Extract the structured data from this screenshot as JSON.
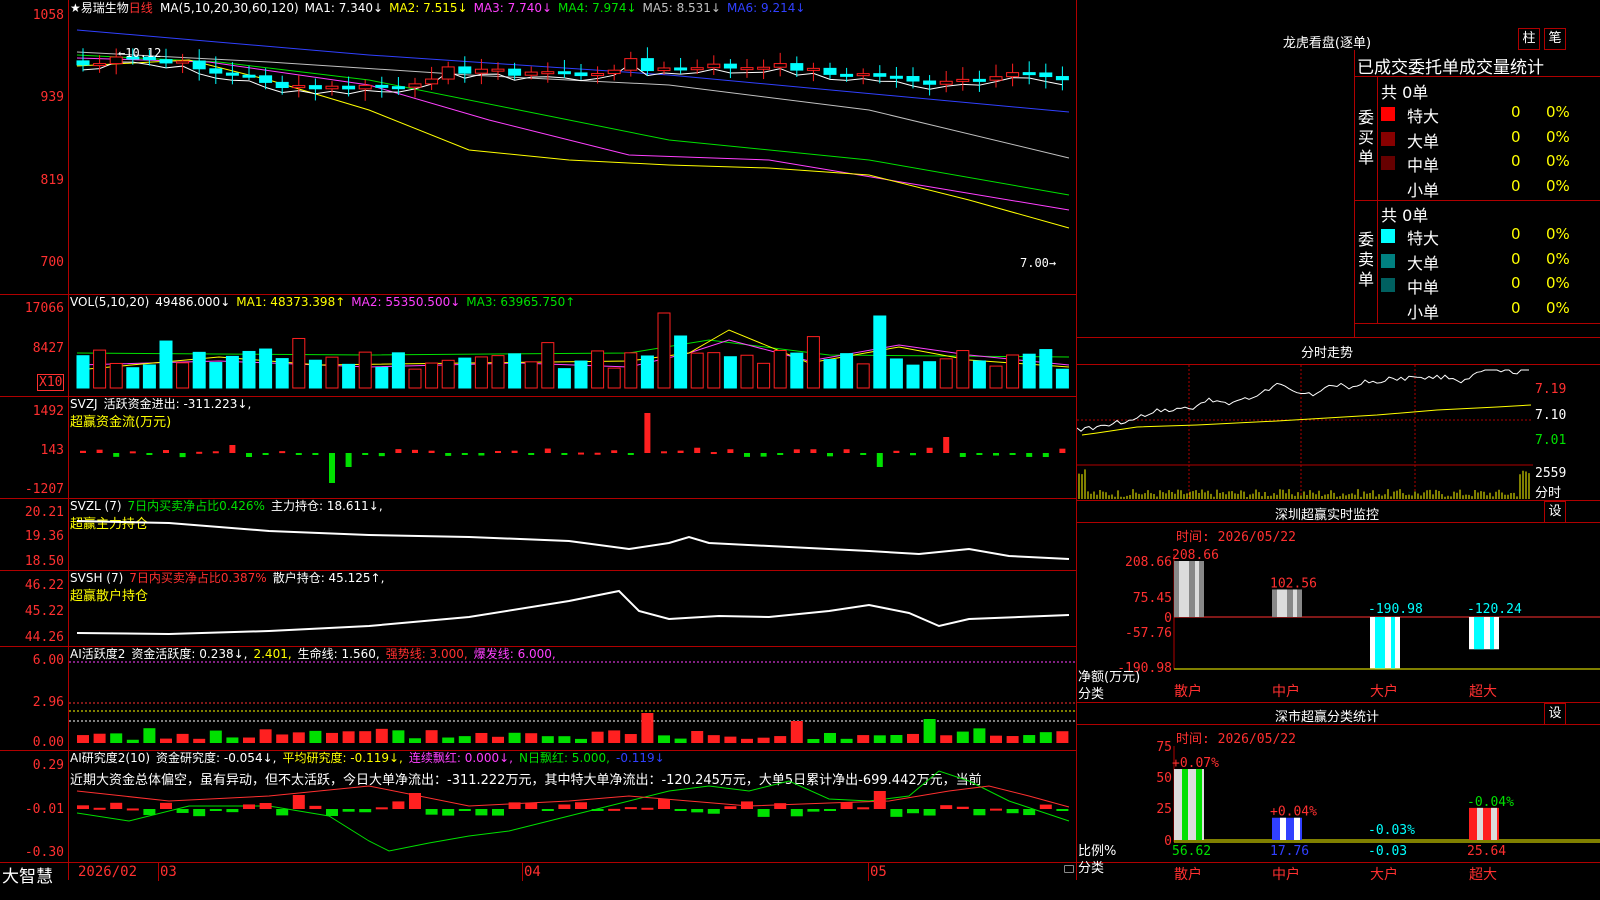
{
  "brand": "大智慧",
  "stock": {
    "name": "★易瑞生物",
    "period": "日线"
  },
  "price_pane": {
    "ma_header": [
      {
        "text": "MA(5,10,20,30,60,120)",
        "color": "#ffffff"
      },
      {
        "text": "MA1: 7.340↓",
        "color": "#ffffff"
      },
      {
        "text": "MA2: 7.515↓",
        "color": "#ffff00"
      },
      {
        "text": "MA3: 7.740↓",
        "color": "#ff40ff"
      },
      {
        "text": "MA4: 7.974↓",
        "color": "#00e000"
      },
      {
        "text": "MA5: 8.531↓",
        "color": "#c0c0c0"
      },
      {
        "text": "MA6: 9.214↓",
        "color": "#3040ff"
      }
    ],
    "axis": [
      "1058",
      "939",
      "819",
      "700"
    ],
    "high_label": "←10.12",
    "low_label": "7.00→"
  },
  "vol_pane": {
    "header": [
      {
        "text": "VOL(5,10,20)",
        "color": "#ffffff"
      },
      {
        "text": "49486.000↓",
        "color": "#ffffff"
      },
      {
        "text": "MA1: 48373.398↑",
        "color": "#ffff00"
      },
      {
        "text": "MA2: 55350.500↓",
        "color": "#ff40ff"
      },
      {
        "text": "MA3: 63965.750↑",
        "color": "#00e000"
      }
    ],
    "axis": [
      "17066",
      "8427"
    ],
    "unit": "X10"
  },
  "svzj_pane": {
    "header": [
      {
        "text": "SVZJ",
        "color": "#ffffff"
      },
      {
        "text": "活跃资金进出: -311.223↓,",
        "color": "#ffffff"
      }
    ],
    "subtitle": "超赢资金流(万元)",
    "axis": [
      "1492",
      "143",
      "-1207"
    ]
  },
  "svzl_pane": {
    "header": [
      {
        "text": "SVZL (7)",
        "color": "#ffffff"
      },
      {
        "text": "7日内买卖净占比0.426%",
        "color": "#00e000"
      },
      {
        "text": "主力持仓: 18.611↓,",
        "color": "#ffffff"
      }
    ],
    "subtitle": "超赢主力持仓",
    "axis": [
      "20.21",
      "19.36",
      "18.50"
    ]
  },
  "svsh_pane": {
    "header": [
      {
        "text": "SVSH (7)",
        "color": "#ffffff"
      },
      {
        "text": "7日内买卖净占比0.387%",
        "color": "#ff3030"
      },
      {
        "text": "散户持仓: 45.125↑,",
        "color": "#ffffff"
      }
    ],
    "subtitle": "超赢散户持仓",
    "axis": [
      "46.22",
      "45.22",
      "44.26"
    ]
  },
  "ai_pane": {
    "header": [
      {
        "text": "AI活跃度2",
        "color": "#ffffff"
      },
      {
        "text": "资金活跃度: 0.238↓,",
        "color": "#ffffff"
      },
      {
        "text": "2.401,",
        "color": "#ffff00"
      },
      {
        "text": "生命线: 1.560,",
        "color": "#ffffff"
      },
      {
        "text": "强势线: 3.000,",
        "color": "#ff3030"
      },
      {
        "text": "爆发线: 6.000,",
        "color": "#ff40ff"
      }
    ],
    "axis": [
      "6.00",
      "2.96",
      "0.00"
    ]
  },
  "research_pane": {
    "header": [
      {
        "text": "AI研究度2(10)",
        "color": "#ffffff"
      },
      {
        "text": "资金研究度: -0.054↓,",
        "color": "#ffffff"
      },
      {
        "text": "平均研究度: -0.119↓,",
        "color": "#ffff00"
      },
      {
        "text": "连续飘红: 0.000↓,",
        "color": "#ff40ff"
      },
      {
        "text": "N日飘红: 5.000,",
        "color": "#00e000"
      },
      {
        "text": "-0.119↓",
        "color": "#3040ff"
      }
    ],
    "summary": "近期大资金总体偏空，虽有异动，但不太活跃，今日大单净流出：-311.222万元，其中特大单净流出：-120.245万元，大单5日累计净出-699.442万元，当前",
    "axis": [
      "0.29",
      "-0.01",
      "-0.30"
    ]
  },
  "date_axis": [
    "2026/02",
    "03",
    "04",
    "05"
  ],
  "right": {
    "lhb": {
      "title": "龙虎看盘(逐单)",
      "btn1": "柱",
      "btn2": "笔",
      "subtitle": "已成交委托单成交量统计",
      "buy_label": "委买单",
      "sell_label": "委卖单",
      "buy_total": "共 0单",
      "sell_total": "共 0单",
      "buy_rows": [
        {
          "name": "特大",
          "vol": "0",
          "pct": "0%",
          "color": "#ff0000"
        },
        {
          "name": "大单",
          "vol": "0",
          "pct": "0%",
          "color": "#880000"
        },
        {
          "name": "中单",
          "vol": "0",
          "pct": "0%",
          "color": "#660000"
        },
        {
          "name": "小单",
          "vol": "0",
          "pct": "0%",
          "color": "#000000"
        }
      ],
      "sell_rows": [
        {
          "name": "特大",
          "vol": "0",
          "pct": "0%",
          "color": "#00ffff"
        },
        {
          "name": "大单",
          "vol": "0",
          "pct": "0%",
          "color": "#008080"
        },
        {
          "name": "中单",
          "vol": "0",
          "pct": "0%",
          "color": "#006060"
        },
        {
          "name": "小单",
          "vol": "0",
          "pct": "0%",
          "color": "#000000"
        }
      ]
    },
    "intraday": {
      "title": "分时走势",
      "price_axis": [
        "7.19",
        "7.10",
        "7.01"
      ],
      "vol_axis": "2559",
      "vol_label": "分时"
    },
    "monitor": {
      "title": "深圳超赢实时监控",
      "btn": "设",
      "time": "时间: 2026/05/22",
      "axis": [
        "208.66",
        "75.45",
        "0",
        "-57.76",
        "-190.98"
      ],
      "bar_labels": [
        "208.66",
        "102.56",
        "-190.98",
        "-120.24"
      ],
      "unit": "净额(万元)",
      "cat_label": "分类",
      "categories": [
        "散户",
        "中户",
        "大户",
        "超大"
      ]
    },
    "classify": {
      "title": "深市超赢分类统计",
      "btn": "设",
      "time": "时间: 2026/05/22",
      "axis": [
        "75",
        "50",
        "25",
        "0"
      ],
      "bar_labels": [
        "+0.07%",
        "+0.04%",
        "-0.03%",
        "-0.04%"
      ],
      "values": [
        "56.62",
        "17.76",
        "-0.03",
        "25.64"
      ],
      "unit": "比例%",
      "cat_label": "分类",
      "categories": [
        "散户",
        "中户",
        "大户",
        "超大"
      ]
    }
  }
}
